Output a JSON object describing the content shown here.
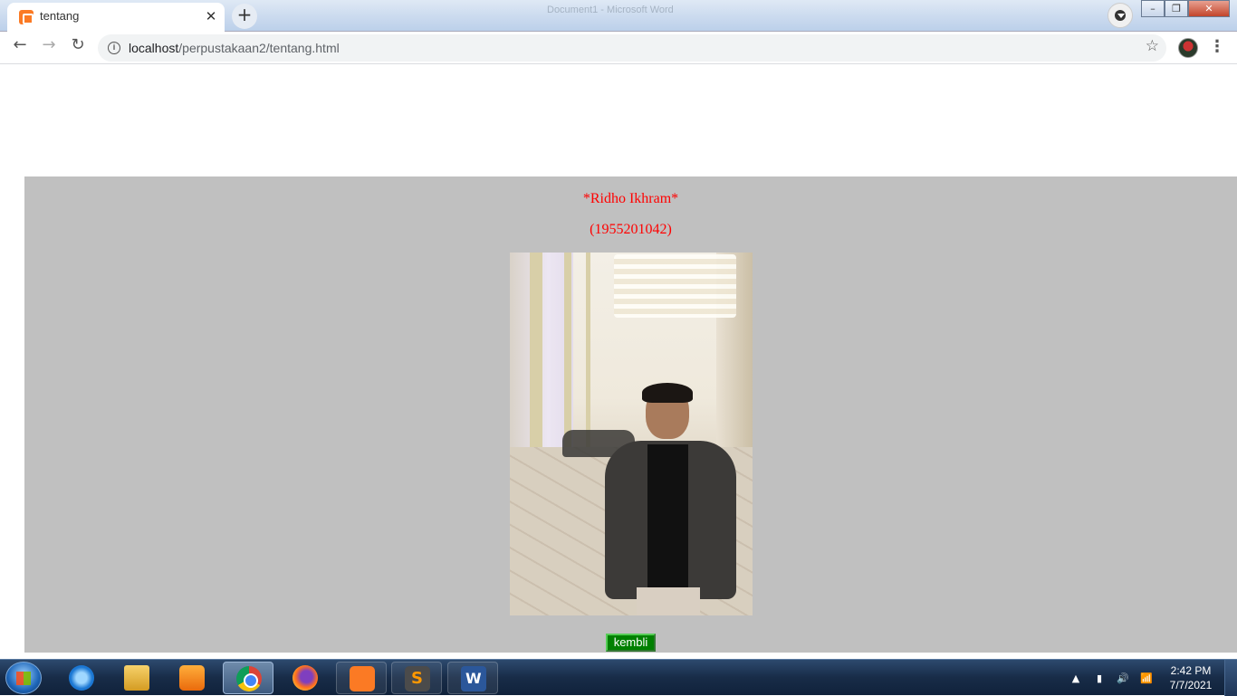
{
  "browser": {
    "tab_title": "tentang",
    "tab_close": "✕",
    "new_tab": "+",
    "background_window_title": "Document1 - Microsoft Word",
    "url_host": "localhost",
    "url_path": "/perpustakaan2/tentang.html",
    "nav": {
      "back": "←",
      "forward": "→",
      "reload": "↻"
    },
    "star": "☆",
    "menu": "⋮",
    "window_buttons": {
      "minimize": "–",
      "maximize": "❐",
      "close": "✕"
    }
  },
  "page": {
    "name": "*Ridho Ikhram*",
    "nim": "(1955201042)",
    "back_button": "kembli",
    "panel_color": "#c0c0c0",
    "text_color": "#ff0000",
    "button_color": "#008000"
  },
  "taskbar": {
    "apps": [
      "Internet Explorer",
      "Windows Explorer",
      "Windows Media Player",
      "Google Chrome",
      "Firefox",
      "XAMPP",
      "Sublime Text",
      "Microsoft Word"
    ],
    "active_app": "Google Chrome",
    "tray": {
      "up_arrow": "▲",
      "battery": "▮",
      "volume": "🔊",
      "network": "📶"
    },
    "time": "2:42 PM",
    "date": "7/7/2021"
  }
}
